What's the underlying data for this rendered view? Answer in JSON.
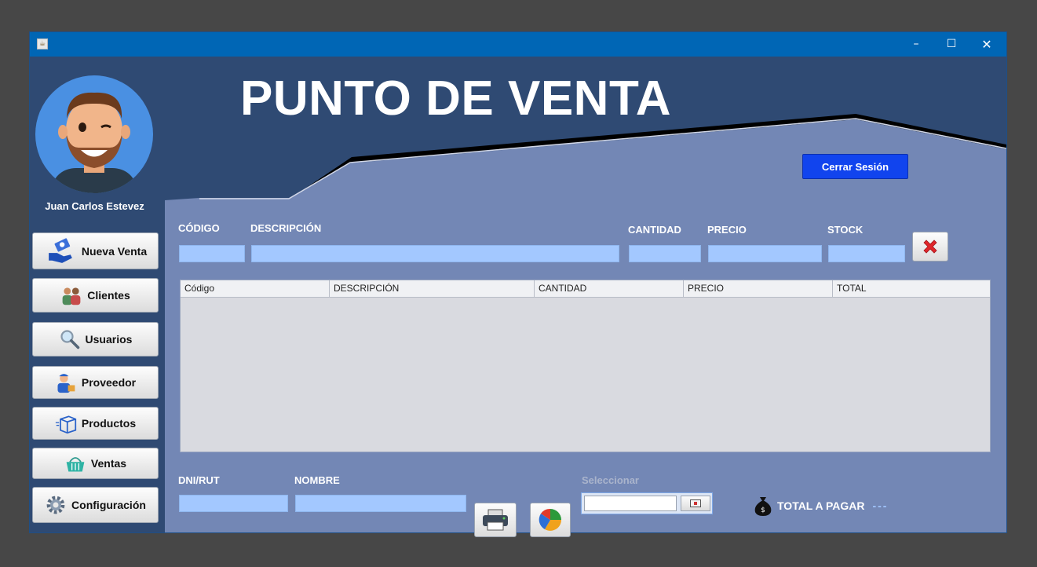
{
  "window": {
    "minimize_glyph": "–",
    "maximize_glyph": "☐",
    "close_glyph": "✕"
  },
  "header": {
    "title": "PUNTO DE VENTA",
    "user_name": "Juan Carlos Estevez",
    "logout_label": "Cerrar Sesión"
  },
  "sidebar": {
    "items": [
      {
        "label": "Nueva Venta",
        "icon": "money-hand-icon"
      },
      {
        "label": "Clientes",
        "icon": "people-icon"
      },
      {
        "label": "Usuarios",
        "icon": "magnifier-icon"
      },
      {
        "label": "Proveedor",
        "icon": "delivery-man-icon"
      },
      {
        "label": "Productos",
        "icon": "box-icon"
      },
      {
        "label": "Ventas",
        "icon": "shopping-basket-icon"
      },
      {
        "label": "Configuración",
        "icon": "gear-icon"
      }
    ]
  },
  "entry_form": {
    "code_label": "CÓDIGO",
    "description_label": "DESCRIPCIÓN",
    "quantity_label": "CANTIDAD",
    "price_label": "PRECIO",
    "stock_label": "STOCK"
  },
  "table": {
    "columns": [
      "Código",
      "DESCRIPCIÓN",
      "CANTIDAD",
      "PRECIO",
      "TOTAL"
    ],
    "rows": []
  },
  "footer": {
    "dni_label": "DNI/RUT",
    "name_label": "NOMBRE",
    "date_label": "Seleccionar",
    "total_label": "TOTAL A PAGAR",
    "total_value": "---"
  },
  "colors": {
    "titlebar": "#0066b5",
    "header_bg": "#2f4a73",
    "panel_bg": "#7387b5",
    "field_bg": "#a3c8ff",
    "logout_button": "#1144ee"
  }
}
